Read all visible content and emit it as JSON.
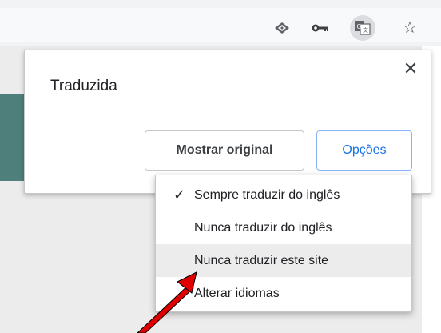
{
  "toolbar": {
    "icons": [
      "extension-icon",
      "key-icon",
      "translate-icon",
      "star-icon"
    ]
  },
  "bubble": {
    "title": "Traduzida",
    "close_label": "✕",
    "show_original_label": "Mostrar original",
    "options_label": "Opções"
  },
  "menu": {
    "items": [
      {
        "label": "Sempre traduzir do inglês",
        "checked": true
      },
      {
        "label": "Nunca traduzir do inglês",
        "checked": false
      },
      {
        "label": "Nunca traduzir este site",
        "checked": false
      },
      {
        "label": "Alterar idiomas",
        "checked": false
      }
    ],
    "checkmark": "✓"
  },
  "colors": {
    "accent": "#1a73e8",
    "band": "#4e7f7a",
    "annotation_arrow": "#e00000"
  }
}
